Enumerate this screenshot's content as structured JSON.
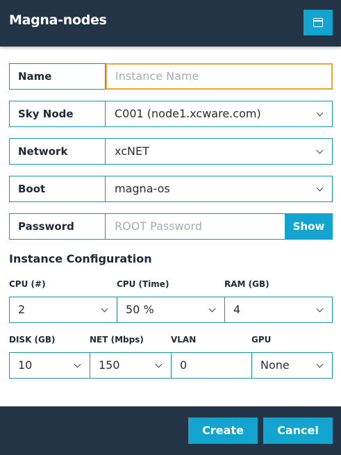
{
  "header": {
    "title": "Magna-nodes"
  },
  "form": {
    "name": {
      "label": "Name",
      "placeholder": "Instance Name"
    },
    "sky_node": {
      "label": "Sky Node",
      "value": "C001 (node1.xcware.com)"
    },
    "network": {
      "label": "Network",
      "value": "xcNET"
    },
    "boot": {
      "label": "Boot",
      "value": "magna-os"
    },
    "password": {
      "label": "Password",
      "placeholder": "ROOT Password",
      "show_label": "Show"
    }
  },
  "config": {
    "title": "Instance Configuration",
    "cpu": {
      "label": "CPU (#)",
      "value": "2"
    },
    "cpu_time": {
      "label": "CPU (Time)",
      "value": "50 %"
    },
    "ram": {
      "label": "RAM (GB)",
      "value": "4"
    },
    "disk": {
      "label": "DISK (GB)",
      "value": "10"
    },
    "net": {
      "label": "NET (Mbps)",
      "value": "150"
    },
    "vlan": {
      "label": "VLAN",
      "value": "0"
    },
    "gpu": {
      "label": "GPU",
      "value": "None"
    }
  },
  "footer": {
    "create_label": "Create",
    "cancel_label": "Cancel"
  },
  "colors": {
    "accent": "#13a5cf",
    "header_bg": "#243447",
    "border": "#1795a8",
    "focus": "#f0a431"
  },
  "icons": {
    "header_button": "window-icon",
    "select": "chevron-down-icon"
  }
}
